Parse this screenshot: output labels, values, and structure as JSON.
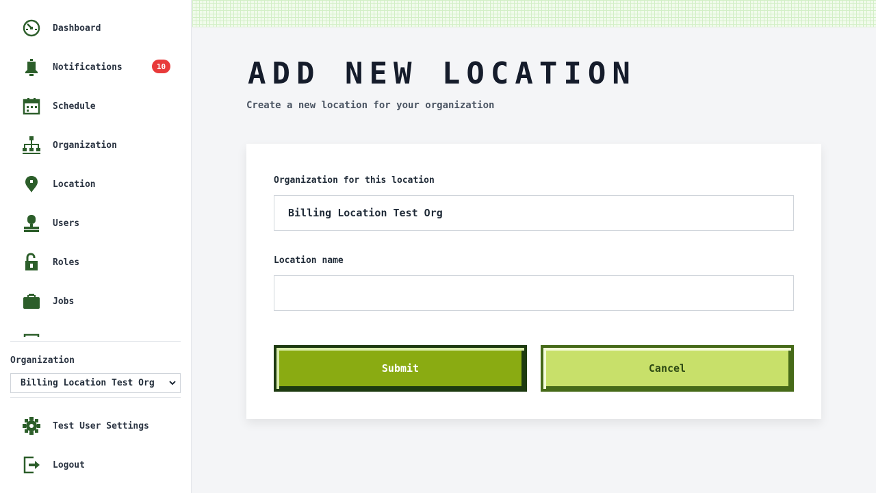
{
  "sidebar": {
    "items": [
      {
        "label": "Dashboard",
        "icon": "dashboard-icon"
      },
      {
        "label": "Notifications",
        "icon": "bell-icon",
        "badge": "10"
      },
      {
        "label": "Schedule",
        "icon": "calendar-icon"
      },
      {
        "label": "Organization",
        "icon": "org-chart-icon"
      },
      {
        "label": "Location",
        "icon": "location-pin-icon"
      },
      {
        "label": "Users",
        "icon": "user-icon"
      },
      {
        "label": "Roles",
        "icon": "lock-icon"
      },
      {
        "label": "Jobs",
        "icon": "briefcase-icon"
      }
    ],
    "organization_label": "Organization",
    "organization_selected": "Billing Location Test Org",
    "bottom_items": [
      {
        "label": "Test User Settings",
        "icon": "gear-icon"
      },
      {
        "label": "Logout",
        "icon": "logout-icon"
      }
    ]
  },
  "main": {
    "title": "ADD NEW LOCATION",
    "subtitle": "Create a new location for your organization",
    "form": {
      "org_field_label": "Organization for this location",
      "org_field_value": "Billing Location Test Org",
      "name_field_label": "Location name",
      "name_field_value": "",
      "name_field_placeholder": "",
      "submit_label": "Submit",
      "cancel_label": "Cancel"
    }
  },
  "colors": {
    "icon": "#2c5e2a",
    "badge": "#e83a3a",
    "submit": "#8aab12",
    "cancel": "#c8e06a"
  }
}
